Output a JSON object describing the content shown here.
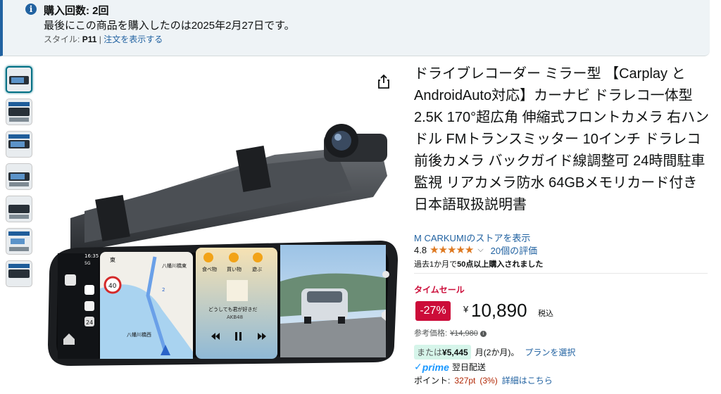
{
  "banner": {
    "info_icon": "info-icon",
    "purchase_count": "購入回数: 2回",
    "last_purchase": "最後にこの商品を購入したのは2025年2月27日です。",
    "style_label": "スタイル:",
    "style_value": "P11",
    "separator": "|",
    "view_order_link": "注文を表示する"
  },
  "gallery": {
    "thumbnail_count": 7,
    "selected_index": 0,
    "share_icon": "share-icon"
  },
  "product_image": {
    "status_time": "16:35",
    "status_signal": "5G",
    "map_label_east": "東",
    "map_label_1": "八幡川橋東",
    "map_label_2": "八幡川橋西",
    "route_number": "2",
    "speed_sign": "40",
    "app_icon_label": "24",
    "app_1": "食べ物",
    "app_2": "買い物",
    "app_3": "遊ぶ",
    "song_title": "どうしても君が好きだ",
    "song_artist": "AKB48"
  },
  "product": {
    "title": "ドライブレコーダー ミラー型 【Carplay とAndroidAuto対応】カーナビ ドラレコ一体型2.5K 170°超広角 伸縮式フロントカメラ 右ハンドル FMトランスミッター 10インチ ドラレコ前後カメラ バックガイド線調整可 24時間駐車監視 リアカメラ防水 64GBメモリカード付き 日本語取扱説明書",
    "store_link": "M CARKUMIのストアを表示",
    "rating": "4.8",
    "stars": "★★★★★",
    "rating_value": 4.8,
    "reviews_link": "20個の評価",
    "bought_prefix": "過去1か月で",
    "bought_bold": "50点以上購入されました",
    "deal_badge": "タイムセール",
    "discount": "-27%",
    "currency": "¥",
    "price": "10,890",
    "tax_label": "税込",
    "ref_price_label": "参考価格:",
    "ref_price": "¥14,980",
    "installment_prefix": "または",
    "installment_amount": "¥5,445",
    "installment_term": "月(2か月)。",
    "installment_link": "プランを選択",
    "prime_check": "✓",
    "prime_word": "prime",
    "prime_delivery": "翌日配送",
    "points_label": "ポイント:",
    "points_value": "327pt",
    "points_pct": "(3%)",
    "points_link": "詳細はこちら"
  },
  "colors": {
    "accent_link": "#2162a1",
    "deal_red": "#cc0c39",
    "star_orange": "#de7921",
    "prime_blue": "#1a98ff"
  }
}
